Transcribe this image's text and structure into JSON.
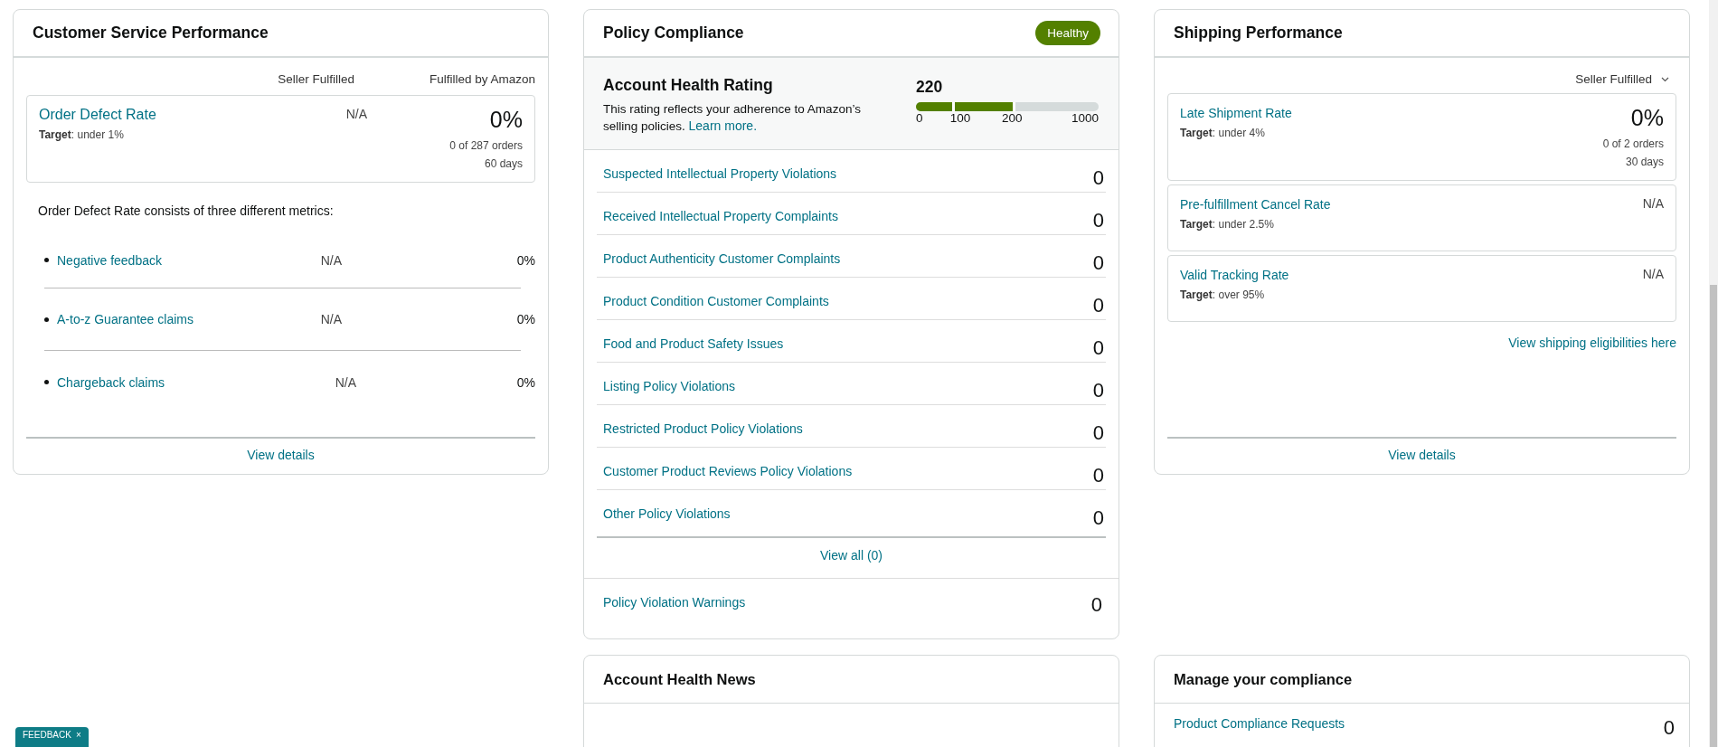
{
  "customer_service": {
    "title": "Customer Service Performance",
    "columns": [
      "Seller Fulfilled",
      "Fulfilled by Amazon"
    ],
    "primary_metric": {
      "name": "Order Defect Rate",
      "target_label": "Target",
      "target": ": under 1%",
      "seller_value": "N/A",
      "fba_value": "0%",
      "orders": "0 of 287 orders",
      "period": "60 days"
    },
    "description": "Order Defect Rate consists of three different metrics:",
    "sub_metrics": [
      {
        "name": "Negative feedback",
        "seller_value": "N/A",
        "fba_value": "0%"
      },
      {
        "name": "A-to-z Guarantee claims",
        "seller_value": "N/A",
        "fba_value": "0%"
      },
      {
        "name": "Chargeback claims",
        "seller_value": "N/A",
        "fba_value": "0%"
      }
    ],
    "view_details": "View details"
  },
  "policy_compliance": {
    "title": "Policy Compliance",
    "status": "Healthy",
    "rating": {
      "title": "Account Health Rating",
      "score": "220",
      "description": "This rating reflects your adherence to Amazon’s selling policies.",
      "link": "Learn more.",
      "level": 0.545,
      "scale": [
        "0",
        "100",
        "200",
        "1000"
      ]
    },
    "violations": [
      {
        "name": "Suspected Intellectual Property Violations",
        "count": "0"
      },
      {
        "name": "Received Intellectual Property Complaints",
        "count": "0"
      },
      {
        "name": "Product Authenticity Customer Complaints",
        "count": "0"
      },
      {
        "name": "Product Condition Customer Complaints",
        "count": "0"
      },
      {
        "name": "Food and Product Safety Issues",
        "count": "0"
      },
      {
        "name": "Listing Policy Violations",
        "count": "0"
      },
      {
        "name": "Restricted Product Policy Violations",
        "count": "0"
      },
      {
        "name": "Customer Product Reviews Policy Violations",
        "count": "0"
      },
      {
        "name": "Other Policy Violations",
        "count": "0"
      }
    ],
    "view_all": "View all (0)",
    "warnings": {
      "name": "Policy Violation Warnings",
      "count": "0"
    }
  },
  "shipping": {
    "title": "Shipping Performance",
    "filter": "Seller Fulfilled",
    "metrics": [
      {
        "name": "Late Shipment Rate",
        "target_label": "Target",
        "target": ": under 4%",
        "value": "0%",
        "orders": "0 of 2 orders",
        "period": "30 days"
      },
      {
        "name": "Pre-fulfillment Cancel Rate",
        "target_label": "Target",
        "target": ": under 2.5%",
        "value": "N/A"
      },
      {
        "name": "Valid Tracking Rate",
        "target_label": "Target",
        "target": ": over 95%",
        "value": "N/A"
      }
    ],
    "eligibility_link": "View shipping eligibilities here",
    "view_details": "View details"
  },
  "news": {
    "title": "Account Health News"
  },
  "manage_compliance": {
    "title": "Manage your compliance",
    "items": [
      {
        "name": "Product Compliance Requests",
        "count": "0"
      }
    ]
  },
  "feedback": {
    "label": "FEEDBACK",
    "close": "×"
  }
}
